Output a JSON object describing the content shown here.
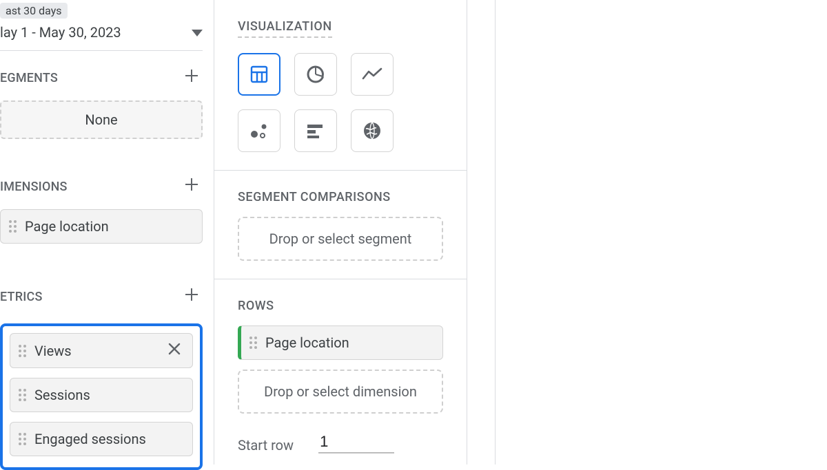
{
  "left": {
    "date_badge": "ast 30 days",
    "date_range": "lay 1 - May 30, 2023",
    "segments_title": "EGMENTS",
    "segments_none": "None",
    "dimensions_title": "IMENSIONS",
    "dimensions_chip": "Page location",
    "metrics_title": "ETRICS",
    "metrics": {
      "views": "Views",
      "sessions": "Sessions",
      "engaged": "Engaged sessions"
    }
  },
  "right": {
    "viz_title": "VISUALIZATION",
    "segment_comp_title": "SEGMENT COMPARISONS",
    "segment_drop": "Drop or select segment",
    "rows_title": "ROWS",
    "rows_chip": "Page location",
    "rows_drop": "Drop or select dimension",
    "start_row_label": "Start row",
    "start_row_value": "1"
  }
}
